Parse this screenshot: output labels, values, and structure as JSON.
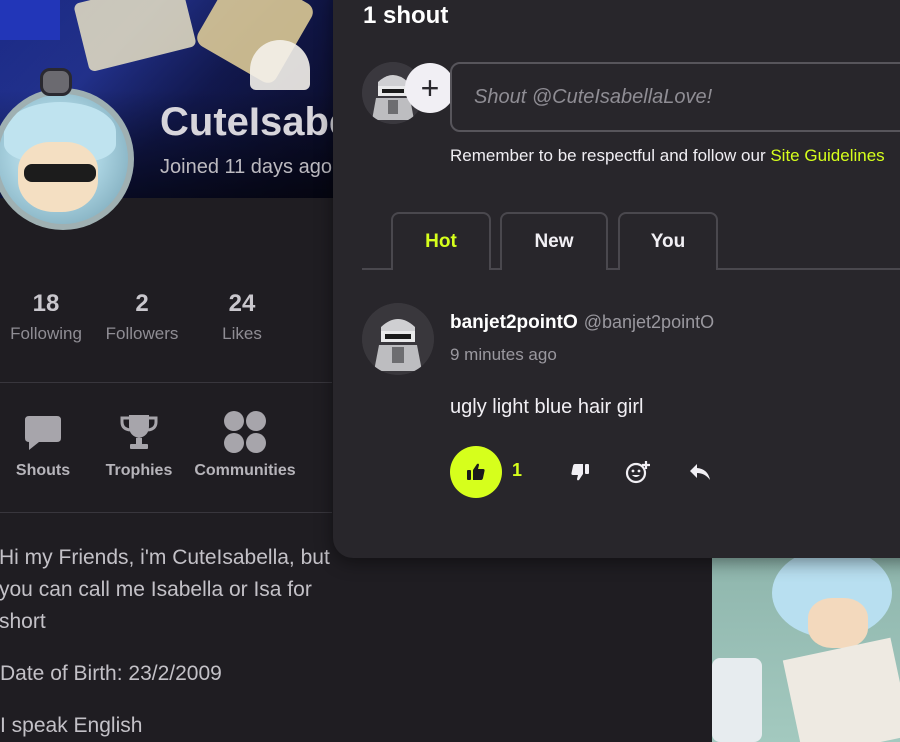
{
  "profile": {
    "name": "CuteIsabella",
    "joined": "Joined 11 days ago",
    "stats": [
      {
        "num": "18",
        "label": "Following"
      },
      {
        "num": "2",
        "label": "Followers"
      },
      {
        "num": "24",
        "label": "Likes"
      }
    ],
    "tiles": [
      {
        "label": "Shouts",
        "icon": "speech-bubble-icon"
      },
      {
        "label": "Trophies",
        "icon": "trophy-icon"
      },
      {
        "label": "Communities",
        "icon": "communities-icon"
      }
    ],
    "bio": {
      "line1": "Hi my Friends, i'm CuteIsabella, but you can call me Isabella or Isa for short",
      "line2": "Date of Birth: 23/2/2009",
      "line3": "I speak English"
    }
  },
  "shouts": {
    "title": "1 shout",
    "input_placeholder": "Shout @CuteIsabellaLove!",
    "add_symbol": "+",
    "reminder_text": "Remember to be respectful and follow our ",
    "reminder_link": "Site Guidelines",
    "tabs": [
      {
        "label": "Hot",
        "active": true
      },
      {
        "label": "New",
        "active": false
      },
      {
        "label": "You",
        "active": false
      }
    ],
    "post": {
      "username": "banjet2pointO",
      "handle": "@banjet2pointO",
      "time": "9 minutes ago",
      "text": "ugly light blue hair girl",
      "like_count": "1"
    }
  },
  "colors": {
    "accent": "#d6ff1c",
    "panel_bg": "#28262b",
    "page_bg": "#1f1d22"
  }
}
